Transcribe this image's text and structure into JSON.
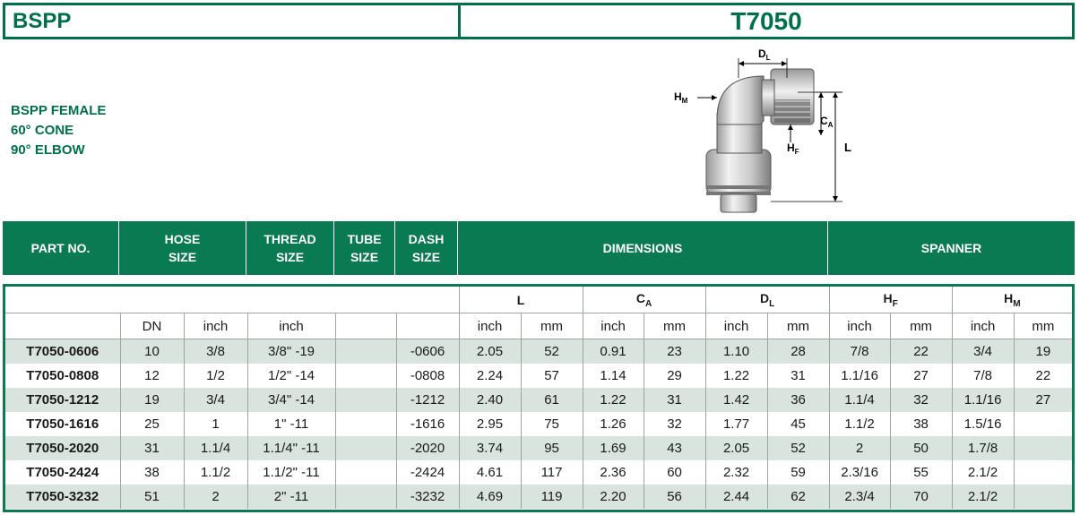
{
  "header": {
    "left_title": "BSPP",
    "right_title": "T7050"
  },
  "description": [
    "BSPP FEMALE",
    "60° CONE",
    "90° ELBOW"
  ],
  "drawing": {
    "labels": {
      "dl": "D",
      "dl_sub": "L",
      "hm": "H",
      "hm_sub": "M",
      "ca": "C",
      "ca_sub": "A",
      "hf": "H",
      "hf_sub": "F",
      "l": "L"
    }
  },
  "band": {
    "part_no": "PART NO.",
    "hose_size": [
      "HOSE",
      "SIZE"
    ],
    "thread_size": [
      "THREAD",
      "SIZE"
    ],
    "tube_size": [
      "TUBE",
      "SIZE"
    ],
    "dash_size": [
      "DASH",
      "SIZE"
    ],
    "dimensions": "DIMENSIONS",
    "spanner": "SPANNER"
  },
  "table": {
    "group_headers": {
      "l": "L",
      "ca": "C",
      "ca_sub": "A",
      "dl": "D",
      "dl_sub": "L",
      "hf": "H",
      "hf_sub": "F",
      "hm": "H",
      "hm_sub": "M"
    },
    "unit_headers": [
      "",
      "DN",
      "inch",
      "inch",
      "",
      "",
      "inch",
      "mm",
      "inch",
      "mm",
      "inch",
      "mm",
      "inch",
      "mm",
      "inch",
      "mm"
    ],
    "rows": [
      [
        "T7050-0606",
        "10",
        "3/8",
        "3/8\" -19",
        "",
        "-0606",
        "2.05",
        "52",
        "0.91",
        "23",
        "1.10",
        "28",
        "7/8",
        "22",
        "3/4",
        "19"
      ],
      [
        "T7050-0808",
        "12",
        "1/2",
        "1/2\" -14",
        "",
        "-0808",
        "2.24",
        "57",
        "1.14",
        "29",
        "1.22",
        "31",
        "1.1/16",
        "27",
        "7/8",
        "22"
      ],
      [
        "T7050-1212",
        "19",
        "3/4",
        "3/4\" -14",
        "",
        "-1212",
        "2.40",
        "61",
        "1.22",
        "31",
        "1.42",
        "36",
        "1.1/4",
        "32",
        "1.1/16",
        "27"
      ],
      [
        "T7050-1616",
        "25",
        "1",
        "1\" -11",
        "",
        "-1616",
        "2.95",
        "75",
        "1.26",
        "32",
        "1.77",
        "45",
        "1.1/2",
        "38",
        "1.5/16",
        ""
      ],
      [
        "T7050-2020",
        "31",
        "1.1/4",
        "1.1/4\" -11",
        "",
        "-2020",
        "3.74",
        "95",
        "1.69",
        "43",
        "2.05",
        "52",
        "2",
        "50",
        "1.7/8",
        ""
      ],
      [
        "T7050-2424",
        "38",
        "1.1/2",
        "1.1/2\" -11",
        "",
        "-2424",
        "4.61",
        "117",
        "2.36",
        "60",
        "2.32",
        "59",
        "2.3/16",
        "55",
        "2.1/2",
        ""
      ],
      [
        "T7050-3232",
        "51",
        "2",
        "2\" -11",
        "",
        "-3232",
        "4.69",
        "119",
        "2.20",
        "56",
        "2.44",
        "62",
        "2.3/4",
        "70",
        "2.1/2",
        ""
      ]
    ]
  },
  "colors": {
    "brand_green": "#00704a",
    "band_green": "#0a7a52",
    "row_shade": "#d8e4dd"
  }
}
